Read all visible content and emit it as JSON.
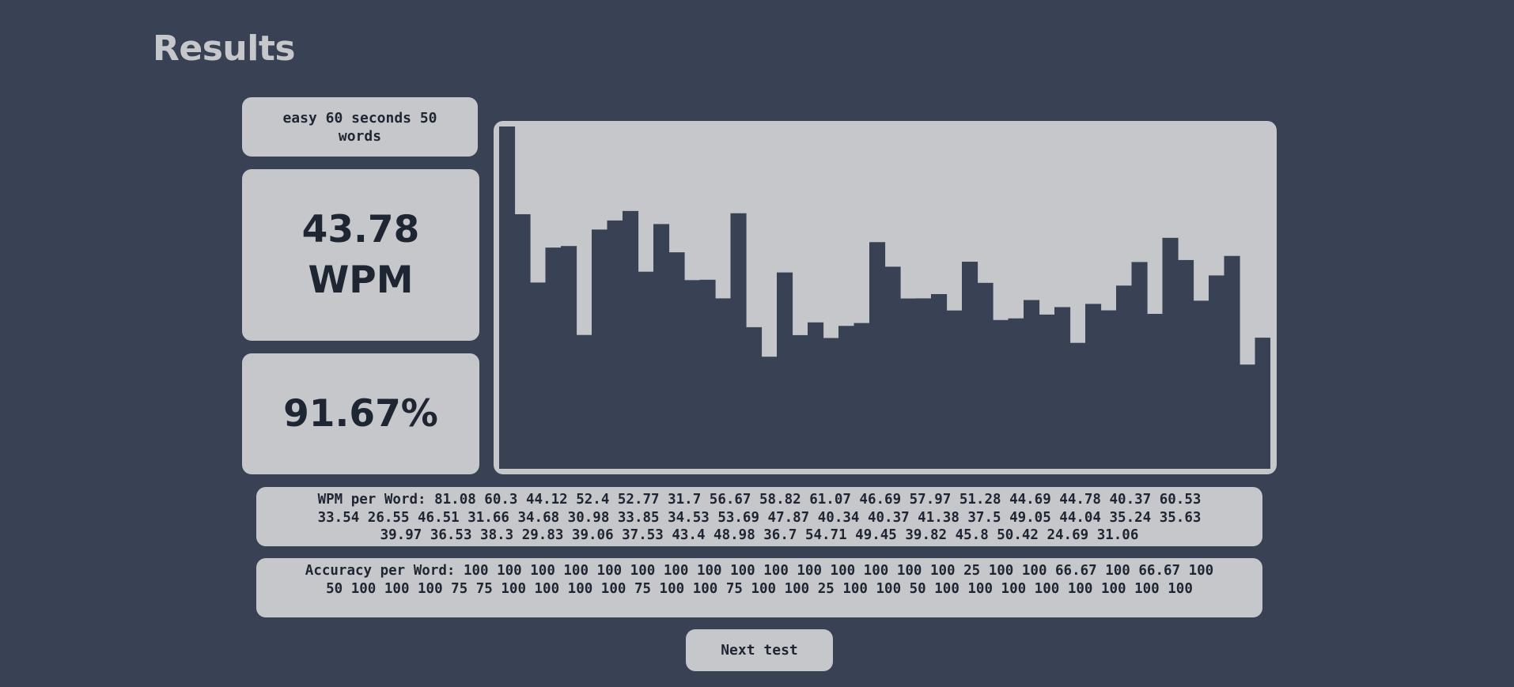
{
  "page": {
    "title": "Results"
  },
  "summary": {
    "mode": "easy 60 seconds 50 words",
    "wpm_value": "43.78",
    "wpm_unit": "WPM",
    "accuracy": "91.67%"
  },
  "wpm_per_word_text": "WPM per Word: 81.08 60.3 44.12 52.4 52.77 31.7 56.67 58.82 61.07 46.69 57.97 51.28 44.69 44.78 40.37 60.53 33.54 26.55 46.51 31.66 34.68 30.98 33.85 34.53 53.69 47.87 40.34 40.37 41.38 37.5 49.05 44.04 35.24 35.63 39.97 36.53 38.3 29.83 39.06 37.53 43.4 48.98 36.7 54.71 49.45 39.82 45.8 50.42 24.69 31.06",
  "accuracy_per_word_text": "Accuracy per Word: 100 100 100 100 100 100 100 100 100 100 100 100 100 100 100 25 100 100 66.67 100 66.67 100 50 100 100 100 75 75 100 100 100 100 75 100 100 75 100 100 25 100 100 50 100 100 100 100 100 100 100 100",
  "next_button": {
    "label": "Next test"
  },
  "colors": {
    "background": "#394254",
    "card": "#c6c7cb",
    "bar": "#394254",
    "text": "#1f2633"
  },
  "chart_data": {
    "type": "bar",
    "title": "",
    "xlabel": "",
    "ylabel": "",
    "ylim": [
      0,
      81.08
    ],
    "grid": false,
    "values": [
      81.08,
      60.3,
      44.12,
      52.4,
      52.77,
      31.7,
      56.67,
      58.82,
      61.07,
      46.69,
      57.97,
      51.28,
      44.69,
      44.78,
      40.37,
      60.53,
      33.54,
      26.55,
      46.51,
      31.66,
      34.68,
      30.98,
      33.85,
      34.53,
      53.69,
      47.87,
      40.34,
      40.37,
      41.38,
      37.5,
      49.05,
      44.04,
      35.24,
      35.63,
      39.97,
      36.53,
      38.3,
      29.83,
      39.06,
      37.53,
      43.4,
      48.98,
      36.7,
      54.71,
      49.45,
      39.82,
      45.8,
      50.42,
      24.69,
      31.06
    ]
  }
}
